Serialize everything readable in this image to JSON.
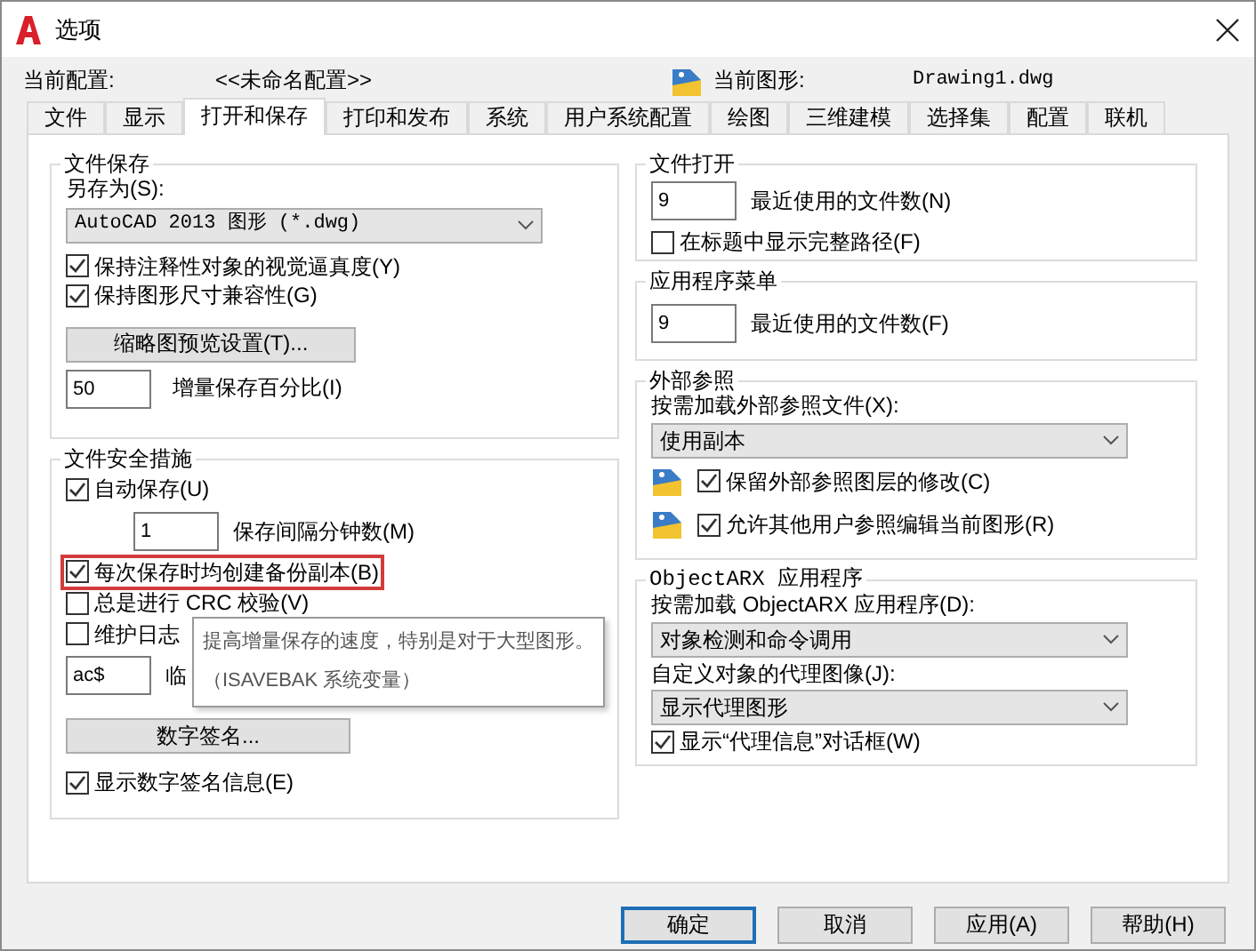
{
  "window": {
    "title": "选项"
  },
  "profile": {
    "current_profile_label": "当前配置:",
    "current_profile": "<<未命名配置>>",
    "current_drawing_label": "当前图形:",
    "current_drawing": "Drawing1.dwg"
  },
  "tabs": [
    {
      "label": "文件",
      "selected": false
    },
    {
      "label": "显示",
      "selected": false
    },
    {
      "label": "打开和保存",
      "selected": true
    },
    {
      "label": "打印和发布",
      "selected": false
    },
    {
      "label": "系统",
      "selected": false
    },
    {
      "label": "用户系统配置",
      "selected": false
    },
    {
      "label": "绘图",
      "selected": false
    },
    {
      "label": "三维建模",
      "selected": false
    },
    {
      "label": "选择集",
      "selected": false
    },
    {
      "label": "配置",
      "selected": false
    },
    {
      "label": "联机",
      "selected": false
    }
  ],
  "file_save": {
    "title": "文件保存",
    "save_as_label": "另存为(S):",
    "save_as_value": "AutoCAD 2013 图形 (*.dwg)",
    "checkboxes": [
      {
        "label": "保持注释性对象的视觉逼真度(Y)",
        "checked": true
      },
      {
        "label": "保持图形尺寸兼容性(G)",
        "checked": true
      }
    ],
    "thumbnail_button": "缩略图预览设置(T)...",
    "incremental_value": "50",
    "incremental_label": "增量保存百分比(I)"
  },
  "file_safety": {
    "title": "文件安全措施",
    "rows": [
      {
        "kind": "checkbox",
        "label": "自动保存(U)",
        "checked": true,
        "highlighted": false
      },
      {
        "kind": "field",
        "value": "1",
        "caption": "保存间隔分钟数(M)"
      },
      {
        "kind": "checkbox",
        "label": "每次保存时均创建备份副本(B)",
        "checked": true,
        "highlighted": true
      },
      {
        "kind": "checkbox",
        "label": "总是进行 CRC 校验(V)",
        "checked": false,
        "highlighted": false
      },
      {
        "kind": "checkbox",
        "label": "维护日志",
        "checked": false,
        "highlighted": false
      },
      {
        "kind": "field",
        "value": "ac$",
        "caption": "临"
      },
      {
        "kind": "button",
        "label": "数字签名..."
      },
      {
        "kind": "checkbox",
        "label": "显示数字签名信息(E)",
        "checked": true,
        "highlighted": false
      }
    ]
  },
  "tooltip": {
    "lines": [
      "提高增量保存的速度，特别是对于大型图形。",
      "（ISAVEBAK 系统变量）"
    ]
  },
  "file_open": {
    "title": "文件打开",
    "recent_value": "9",
    "recent_label": "最近使用的文件数(N)",
    "checkbox": {
      "label": "在标题中显示完整路径(F)",
      "checked": false
    }
  },
  "app_menu": {
    "title": "应用程序菜单",
    "recent_value": "9",
    "recent_label": "最近使用的文件数(F)"
  },
  "xref": {
    "title": "外部参照",
    "load_label": "按需加载外部参照文件(X):",
    "load_value": "使用副本",
    "checkboxes": [
      {
        "label": "保留外部参照图层的修改(C)",
        "checked": true
      },
      {
        "label": "允许其他用户参照编辑当前图形(R)",
        "checked": true
      }
    ]
  },
  "objectarx": {
    "title": "ObjectARX 应用程序",
    "load_label": "按需加载 ObjectARX 应用程序(D):",
    "load_value": "对象检测和命令调用",
    "proxy_label": "自定义对象的代理图像(J):",
    "proxy_value": "显示代理图形",
    "checkbox": {
      "label": "显示“代理信息”对话框(W)",
      "checked": true
    }
  },
  "buttons": [
    {
      "label": "确定",
      "default": true
    },
    {
      "label": "取消",
      "default": false
    },
    {
      "label": "应用(A)",
      "default": false
    },
    {
      "label": "帮助(H)",
      "default": false
    }
  ]
}
